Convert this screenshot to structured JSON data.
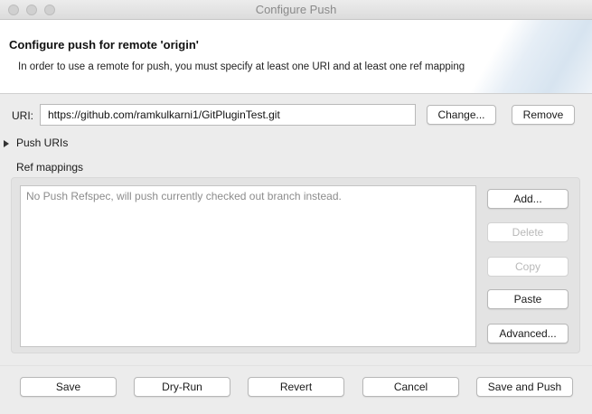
{
  "window": {
    "title": "Configure Push"
  },
  "header": {
    "title": "Configure push for remote 'origin'",
    "description": "In order to use a remote for push, you must specify at least one URI and at least one ref mapping"
  },
  "uri": {
    "label": "URI:",
    "value": "https://github.com/ramkulkarni1/GitPluginTest.git",
    "change_label": "Change...",
    "remove_label": "Remove"
  },
  "push_uris": {
    "label": "Push URIs",
    "expanded": false
  },
  "ref_mappings": {
    "label": "Ref mappings",
    "items": [
      "No Push Refspec, will push currently checked out branch instead."
    ],
    "buttons": {
      "add": "Add...",
      "delete": "Delete",
      "copy": "Copy",
      "paste": "Paste",
      "advanced": "Advanced..."
    },
    "disabled": [
      "delete",
      "copy"
    ]
  },
  "footer": {
    "save": "Save",
    "dry_run": "Dry-Run",
    "revert": "Revert",
    "cancel": "Cancel",
    "save_and_push": "Save and Push"
  }
}
